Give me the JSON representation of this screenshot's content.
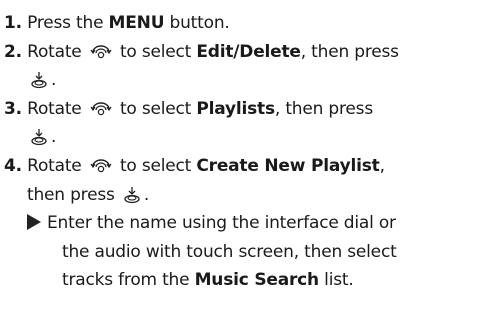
{
  "steps": [
    {
      "num": "1.",
      "pre": " Press the ",
      "bold": "MENU",
      "post": " button."
    },
    {
      "num": "2.",
      "pre": " Rotate ",
      "mid": " to select ",
      "bold": "Edit/Delete",
      "post": ", then press"
    },
    {
      "num": "3.",
      "pre": " Rotate ",
      "mid": " to select ",
      "bold": "Playlists",
      "post": ", then press"
    },
    {
      "num": "4.",
      "pre": " Rotate ",
      "mid": " to select ",
      "bold": "Create New Playlist",
      "post": ","
    }
  ],
  "step4_line2": "then press ",
  "period": ".",
  "result": {
    "line1": "Enter the name using the interface dial or",
    "line2": "the audio with touch screen, then select",
    "line3_pre": "tracks from the ",
    "line3_bold": "Music Search",
    "line3_post": " list."
  },
  "icons": {
    "rotate": "rotate-dial-icon",
    "press": "press-dial-icon"
  }
}
